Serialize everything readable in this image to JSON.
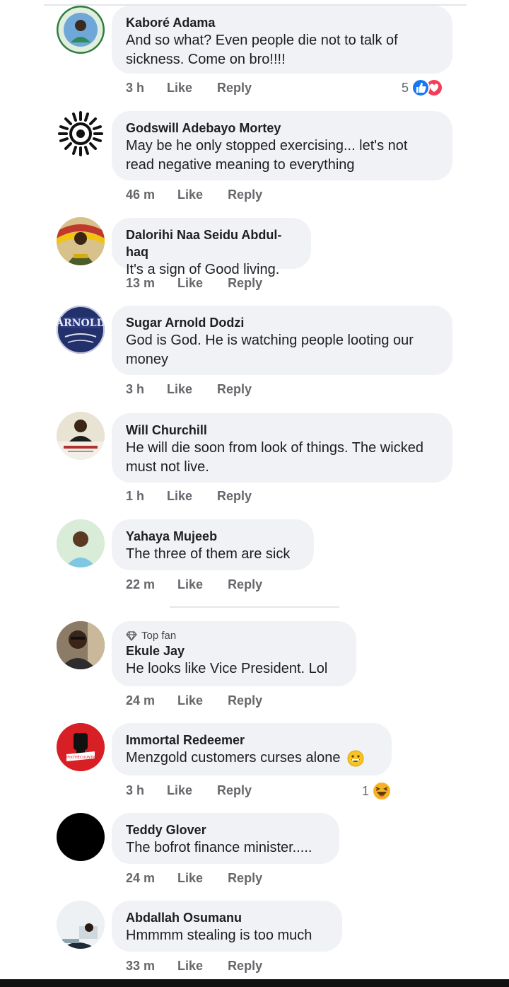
{
  "comments": [
    {
      "author": "Kaboré Adama",
      "text": "And so what? Even people die not to talk of sickness.  Come on bro!!!!",
      "time": "3 h",
      "like": "Like",
      "reply": "Reply",
      "reactions": "5"
    },
    {
      "author": "Godswill Adebayo Mortey",
      "text": "May be he only stopped exercising... let's not read negative meaning to everything",
      "time": "46 m",
      "like": "Like",
      "reply": "Reply"
    },
    {
      "author": "Dalorihi Naa Seidu Abdul-haq",
      "text": "It's a sign of Good living.",
      "time": "13 m",
      "like": "Like",
      "reply": "Reply"
    },
    {
      "author": "Sugar Arnold Dodzi",
      "text": "God is God. He is watching people looting our money",
      "time": "3 h",
      "like": "Like",
      "reply": "Reply"
    },
    {
      "author": "Will Churchill",
      "text": "He will die soon from look of things. The wicked must not live.",
      "time": "1 h",
      "like": "Like",
      "reply": "Reply"
    },
    {
      "author": "Yahaya Mujeeb",
      "text": "The three of them are sick",
      "time": "22 m",
      "like": "Like",
      "reply": "Reply"
    },
    {
      "badge": "Top fan",
      "author": "Ekule Jay",
      "text": "He looks like Vice President. Lol",
      "time": "24 m",
      "like": "Like",
      "reply": "Reply"
    },
    {
      "author": "Immortal Redeemer",
      "text": "Menzgold customers curses alone",
      "time": "3 h",
      "like": "Like",
      "reply": "Reply",
      "reactions": "1"
    },
    {
      "author": "Teddy Glover",
      "text": "The bofrot finance minister.....",
      "time": "24 m",
      "like": "Like",
      "reply": "Reply"
    },
    {
      "author": "Abdallah Osumanu",
      "text": "Hmmmm stealing is too much",
      "time": "33 m",
      "like": "Like",
      "reply": "Reply"
    }
  ],
  "colors": {
    "bubble": "#f0f2f5",
    "meta": "#65676b",
    "like_blue": "#1877f2",
    "love_red": "#f33e58",
    "haha_yellow": "#f7b125"
  }
}
